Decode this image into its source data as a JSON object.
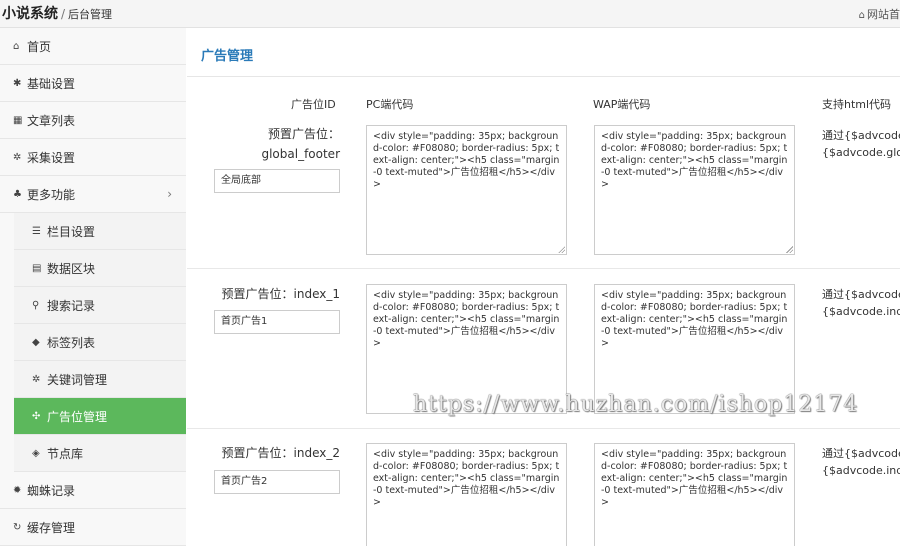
{
  "header": {
    "app_title": "小说系统",
    "separator": "/",
    "subtitle": "后台管理",
    "site_link": "网站首"
  },
  "sidebar": {
    "items": [
      {
        "label": "首页",
        "icon": "home-icon",
        "glyph": "⌂"
      },
      {
        "label": "基础设置",
        "icon": "gear-icon",
        "glyph": "✱"
      },
      {
        "label": "文章列表",
        "icon": "table-icon",
        "glyph": "▦"
      },
      {
        "label": "采集设置",
        "icon": "cogs-icon",
        "glyph": "✲"
      },
      {
        "label": "更多功能",
        "icon": "sitemap-icon",
        "glyph": "♣"
      }
    ],
    "sub_items": [
      {
        "label": "栏目设置",
        "icon": "list-icon",
        "glyph": "☰"
      },
      {
        "label": "数据区块",
        "icon": "database-icon",
        "glyph": "▤"
      },
      {
        "label": "搜索记录",
        "icon": "search-icon",
        "glyph": "⚲"
      },
      {
        "label": "标签列表",
        "icon": "tag-icon",
        "glyph": "◆"
      },
      {
        "label": "关键词管理",
        "icon": "cogs-icon",
        "glyph": "✲"
      },
      {
        "label": "广告位管理",
        "icon": "puzzle-icon",
        "glyph": "✣"
      },
      {
        "label": "节点库",
        "icon": "cube-icon",
        "glyph": "◈"
      }
    ],
    "bottom_items": [
      {
        "label": "蜘蛛记录",
        "icon": "bug-icon",
        "glyph": "✹"
      },
      {
        "label": "缓存管理",
        "icon": "refresh-icon",
        "glyph": "↻"
      }
    ],
    "chevron": "›"
  },
  "main": {
    "title": "广告管理",
    "columns": {
      "id": "广告位ID",
      "pc": "PC端代码",
      "wap": "WAP端代码",
      "html": "支持html代码"
    },
    "rows": [
      {
        "label_line1": "预置广告位：",
        "label_line2": "global_footer",
        "name": "全局底部",
        "pc_code": "<div style=\"padding: 35px; background-color: #F08080; border-radius: 5px; text-align: center;\"><h5 class=\"margin-0 text-muted\">广告位招租</h5></div>",
        "wap_code": "<div style=\"padding: 35px; background-color: #F08080; border-radius: 5px; text-align: center;\"><h5 class=\"margin-0 text-muted\">广告位招租</h5></div>",
        "tip_line1": "通过{$advcode",
        "tip_line2": "{$advcode.glob"
      },
      {
        "label_line1": "预置广告位：index_1",
        "name": "首页广告1",
        "pc_code": "<div style=\"padding: 35px; background-color: #F08080; border-radius: 5px; text-align: center;\"><h5 class=\"margin-0 text-muted\">广告位招租</h5></div>",
        "wap_code": "<div style=\"padding: 35px; background-color: #F08080; border-radius: 5px; text-align: center;\"><h5 class=\"margin-0 text-muted\">广告位招租</h5></div>",
        "tip_line1": "通过{$advcode",
        "tip_line2": "{$advcode.inde"
      },
      {
        "label_line1": "预置广告位：index_2",
        "name": "首页广告2",
        "pc_code": "<div style=\"padding: 35px; background-color: #F08080; border-radius: 5px; text-align: center;\"><h5 class=\"margin-0 text-muted\">广告位招租</h5></div>",
        "wap_code": "<div style=\"padding: 35px; background-color: #F08080; border-radius: 5px; text-align: center;\"><h5 class=\"margin-0 text-muted\">广告位招租</h5></div>",
        "tip_line1": "通过{$advcode",
        "tip_line2": "{$advcode.inde"
      }
    ]
  },
  "watermark": "https://www.huzhan.com/ishop12174",
  "colors": {
    "accent": "#2a7ab8",
    "active": "#5cb85c"
  }
}
